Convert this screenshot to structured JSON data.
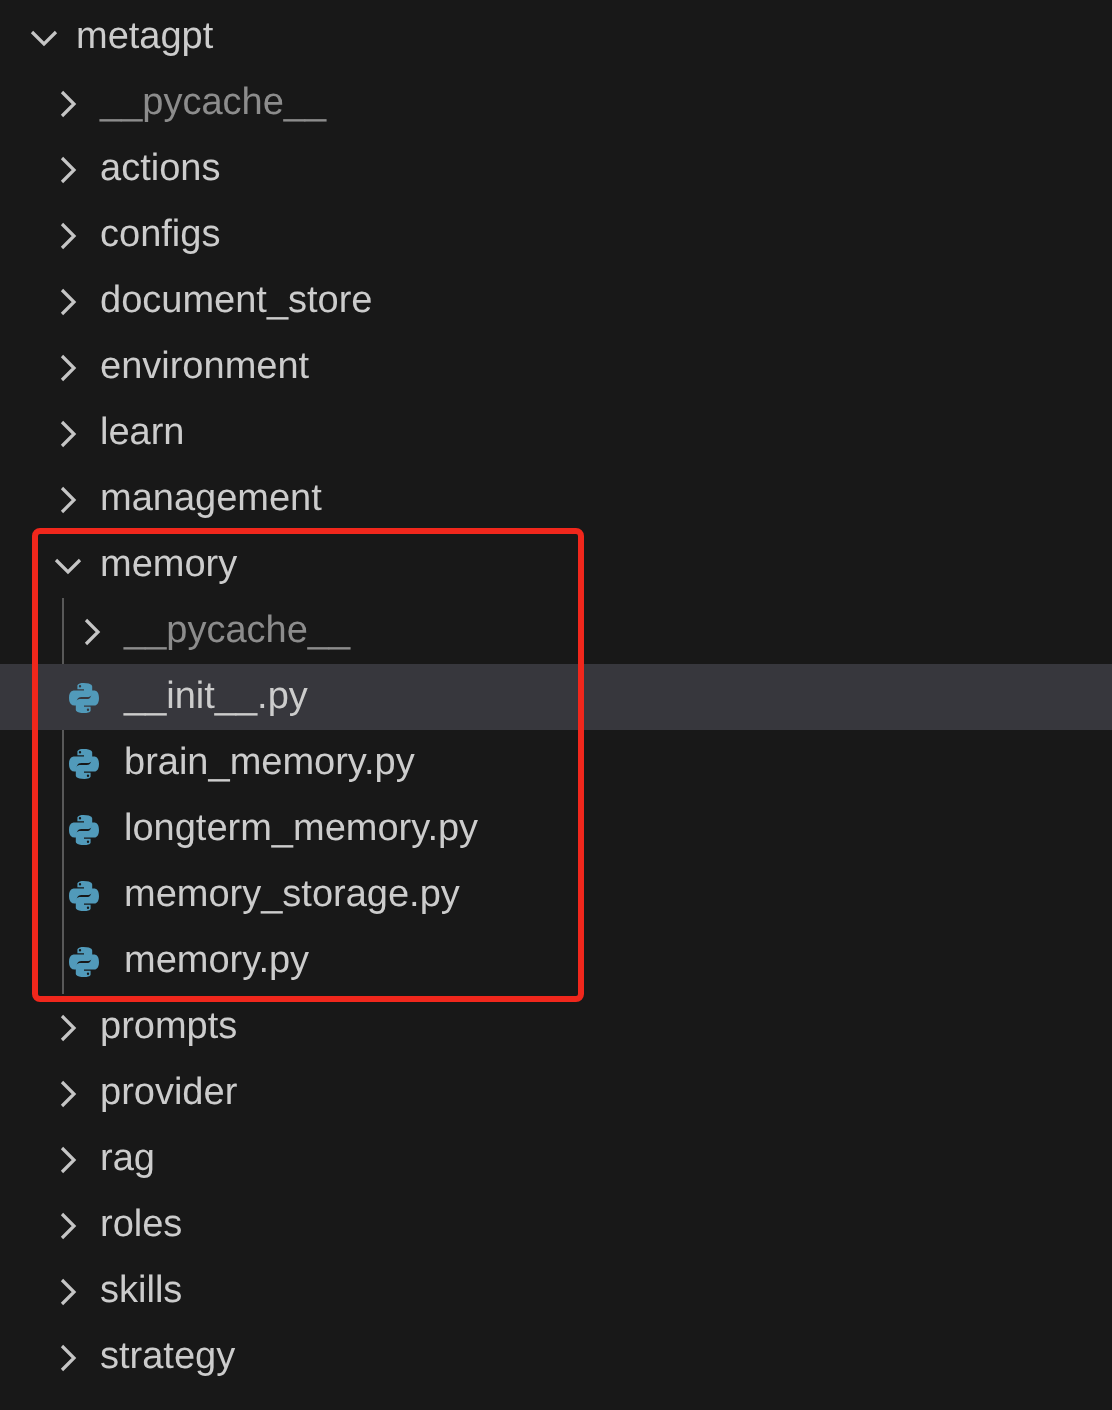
{
  "explorer": {
    "tree": {
      "label": "metagpt",
      "kind": "folder",
      "expanded": true,
      "selected": false,
      "dimmed": false,
      "outlined": false,
      "children": [
        {
          "label": "__pycache__",
          "kind": "folder",
          "expanded": false,
          "selected": false,
          "dimmed": true,
          "outlined": false
        },
        {
          "label": "actions",
          "kind": "folder",
          "expanded": false,
          "selected": false,
          "dimmed": false,
          "outlined": false
        },
        {
          "label": "configs",
          "kind": "folder",
          "expanded": false,
          "selected": false,
          "dimmed": false,
          "outlined": false
        },
        {
          "label": "document_store",
          "kind": "folder",
          "expanded": false,
          "selected": false,
          "dimmed": false,
          "outlined": false
        },
        {
          "label": "environment",
          "kind": "folder",
          "expanded": false,
          "selected": false,
          "dimmed": false,
          "outlined": false
        },
        {
          "label": "learn",
          "kind": "folder",
          "expanded": false,
          "selected": false,
          "dimmed": false,
          "outlined": false
        },
        {
          "label": "management",
          "kind": "folder",
          "expanded": false,
          "selected": false,
          "dimmed": false,
          "outlined": false
        },
        {
          "label": "memory",
          "kind": "folder",
          "expanded": true,
          "selected": false,
          "dimmed": false,
          "outlined": true,
          "children": [
            {
              "label": "__pycache__",
              "kind": "folder",
              "expanded": false,
              "selected": false,
              "dimmed": true,
              "outlined": false
            },
            {
              "label": "__init__.py",
              "kind": "file",
              "selected": true,
              "dimmed": false,
              "outlined": false
            },
            {
              "label": "brain_memory.py",
              "kind": "file",
              "selected": false,
              "dimmed": false,
              "outlined": false
            },
            {
              "label": "longterm_memory.py",
              "kind": "file",
              "selected": false,
              "dimmed": false,
              "outlined": false
            },
            {
              "label": "memory_storage.py",
              "kind": "file",
              "selected": false,
              "dimmed": false,
              "outlined": false
            },
            {
              "label": "memory.py",
              "kind": "file",
              "selected": false,
              "dimmed": false,
              "outlined": false
            }
          ]
        },
        {
          "label": "prompts",
          "kind": "folder",
          "expanded": false,
          "selected": false,
          "dimmed": false,
          "outlined": false
        },
        {
          "label": "provider",
          "kind": "folder",
          "expanded": false,
          "selected": false,
          "dimmed": false,
          "outlined": false
        },
        {
          "label": "rag",
          "kind": "folder",
          "expanded": false,
          "selected": false,
          "dimmed": false,
          "outlined": false
        },
        {
          "label": "roles",
          "kind": "folder",
          "expanded": false,
          "selected": false,
          "dimmed": false,
          "outlined": false
        },
        {
          "label": "skills",
          "kind": "folder",
          "expanded": false,
          "selected": false,
          "dimmed": false,
          "outlined": false
        },
        {
          "label": "strategy",
          "kind": "folder",
          "expanded": false,
          "selected": false,
          "dimmed": false,
          "outlined": false
        }
      ]
    }
  }
}
